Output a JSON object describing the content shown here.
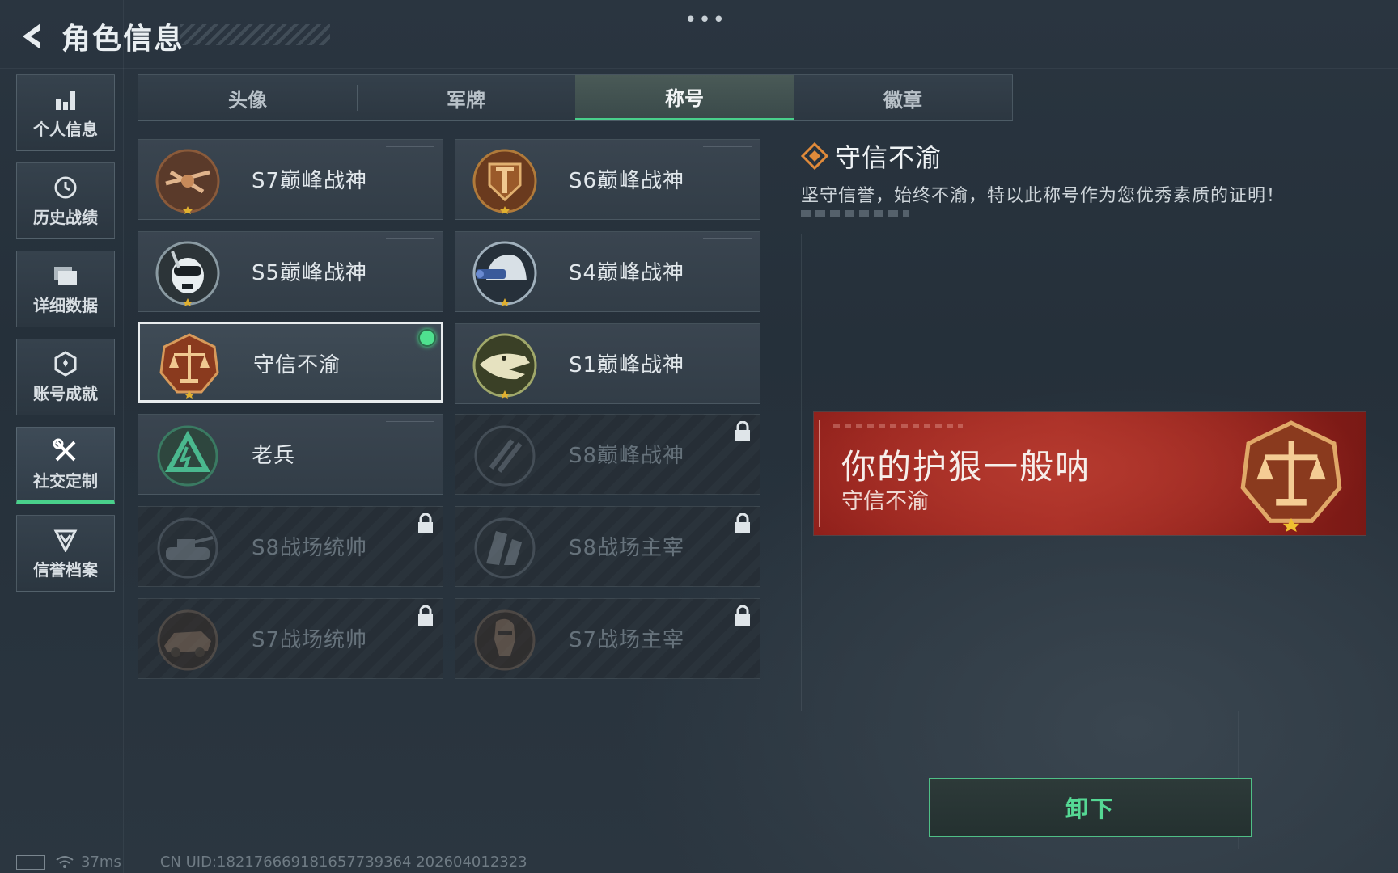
{
  "header": {
    "title": "角色信息",
    "more": "•••"
  },
  "sidebar": {
    "items": [
      {
        "label": "个人信息",
        "icon": "bar-chart-icon"
      },
      {
        "label": "历史战绩",
        "icon": "history-clock-icon"
      },
      {
        "label": "详细数据",
        "icon": "folder-icon"
      },
      {
        "label": "账号成就",
        "icon": "achievement-medal-icon"
      },
      {
        "label": "社交定制",
        "icon": "tools-cross-icon",
        "active": true
      },
      {
        "label": "信誉档案",
        "icon": "shield-chevron-icon"
      }
    ]
  },
  "tabs": [
    {
      "label": "头像"
    },
    {
      "label": "军牌"
    },
    {
      "label": "称号",
      "active": true
    },
    {
      "label": "徽章"
    }
  ],
  "titles": [
    {
      "name": "S7巅峰战神",
      "emblem": "crossbow-emblem",
      "locked": false
    },
    {
      "name": "S6巅峰战神",
      "emblem": "shield-t-emblem",
      "locked": false
    },
    {
      "name": "S5巅峰战神",
      "emblem": "skull-diver-emblem",
      "locked": false
    },
    {
      "name": "S4巅峰战神",
      "emblem": "helmet-nightvision-emblem",
      "locked": false
    },
    {
      "name": "守信不渝",
      "emblem": "scales-emblem",
      "locked": false,
      "selected": true,
      "equipped": true
    },
    {
      "name": "S1巅峰战神",
      "emblem": "crocodile-emblem",
      "locked": false
    },
    {
      "name": "老兵",
      "emblem": "veteran-triangle-emblem",
      "locked": false
    },
    {
      "name": "S8巅峰战神",
      "emblem": "slash-emblem",
      "locked": true
    },
    {
      "name": "S8战场统帅",
      "emblem": "tank-emblem",
      "locked": true
    },
    {
      "name": "S8战场主宰",
      "emblem": "city-emblem",
      "locked": true
    },
    {
      "name": "S7战场统帅",
      "emblem": "vehicle-emblem",
      "locked": true
    },
    {
      "name": "S7战场主宰",
      "emblem": "soldier-emblem",
      "locked": true
    }
  ],
  "detail": {
    "title": "守信不渝",
    "description": "坚守信誉，始终不渝，特以此称号作为您优秀素质的证明！"
  },
  "banner": {
    "player_name": "你的护狠一般呐",
    "title": "守信不渝"
  },
  "actions": {
    "unequip": "卸下"
  },
  "status": {
    "ping": "37ms",
    "uid": "CN UID:1821766691816577393‌64 202604012323"
  },
  "colors": {
    "accent_green": "#49d08b",
    "banner_red": "#a42a22",
    "bronze": "#c07a3c"
  }
}
